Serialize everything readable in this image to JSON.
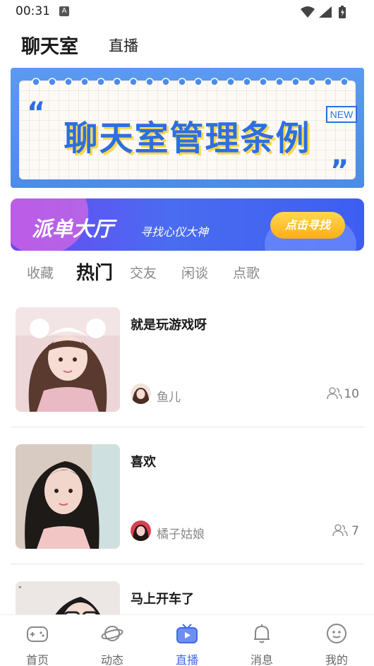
{
  "status_bar": {
    "time": "00:31",
    "notif_letter": "A"
  },
  "top_tabs": {
    "main": "聊天室",
    "live": "直播"
  },
  "rules_banner": {
    "title": "聊天室管理条例",
    "badge": "NEW",
    "quote_open": "“",
    "quote_close": "”"
  },
  "dispatch_banner": {
    "title": "派单大厅",
    "subtitle": "寻找心仪大神",
    "button": "点击寻找"
  },
  "category_tabs": [
    "收藏",
    "热门",
    "交友",
    "闲谈",
    "点歌"
  ],
  "active_category": "热门",
  "rooms": [
    {
      "title": "就是玩游戏呀",
      "host": "鱼儿",
      "count": "10",
      "thumb_color": "#e8c9c9",
      "hair_color": "#5a3a2e"
    },
    {
      "title": "喜欢",
      "host": "橘子姑娘",
      "count": "7",
      "thumb_color": "#d8c8be",
      "hair_color": "#1e1a18"
    },
    {
      "title": "马上开车了",
      "host": "",
      "count": "",
      "thumb_color": "#ece7e4",
      "hair_color": "#1c1a1a"
    }
  ],
  "bottom_nav": [
    {
      "label": "首页",
      "icon": "gamepad-icon"
    },
    {
      "label": "动态",
      "icon": "planet-icon"
    },
    {
      "label": "直播",
      "icon": "tv-icon"
    },
    {
      "label": "消息",
      "icon": "bell-icon"
    },
    {
      "label": "我的",
      "icon": "smiley-icon"
    }
  ],
  "active_nav": "直播",
  "colors": {
    "accent": "#3f6be6",
    "banner_blue": "#4d8be8",
    "dispatch_purple": "#6a48f5",
    "button_orange": "#ffae1a"
  }
}
